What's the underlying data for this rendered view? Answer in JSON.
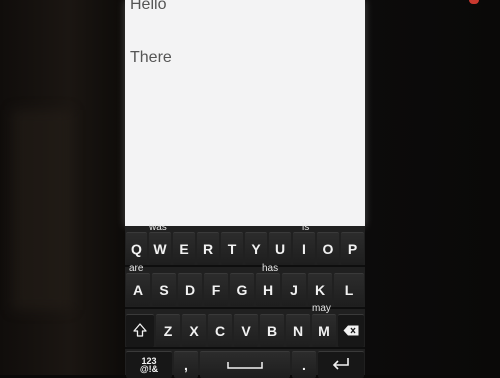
{
  "editor": {
    "lines": [
      "Hello",
      "There"
    ]
  },
  "keyboard": {
    "suggestions": {
      "was": "was",
      "is": "is",
      "are": "are",
      "has": "has",
      "may": "may"
    },
    "row1": [
      "Q",
      "W",
      "E",
      "R",
      "T",
      "Y",
      "U",
      "I",
      "O",
      "P"
    ],
    "row2": [
      "A",
      "S",
      "D",
      "F",
      "G",
      "H",
      "J",
      "K",
      "L"
    ],
    "row3": [
      "Z",
      "X",
      "C",
      "V",
      "B",
      "N",
      "M"
    ],
    "symbols_label": "123\n@!&",
    "comma": ",",
    "period": "."
  },
  "icons": {
    "shift": "shift-icon",
    "backspace": "backspace-icon",
    "space": "space-icon",
    "enter": "enter-icon"
  },
  "colors": {
    "text_area_bg": "#f3f3f4",
    "keyboard_bg": "#202020",
    "key_text": "#f2f2f2",
    "led": "#c9392f"
  }
}
